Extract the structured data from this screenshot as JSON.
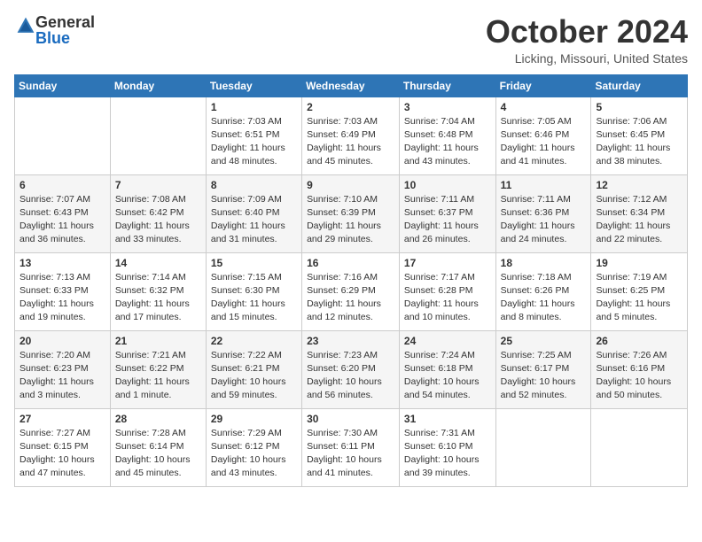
{
  "logo": {
    "general": "General",
    "blue": "Blue"
  },
  "title": "October 2024",
  "location": "Licking, Missouri, United States",
  "headers": [
    "Sunday",
    "Monday",
    "Tuesday",
    "Wednesday",
    "Thursday",
    "Friday",
    "Saturday"
  ],
  "weeks": [
    [
      null,
      null,
      {
        "day": "1",
        "sunrise": "Sunrise: 7:03 AM",
        "sunset": "Sunset: 6:51 PM",
        "daylight": "Daylight: 11 hours and 48 minutes."
      },
      {
        "day": "2",
        "sunrise": "Sunrise: 7:03 AM",
        "sunset": "Sunset: 6:49 PM",
        "daylight": "Daylight: 11 hours and 45 minutes."
      },
      {
        "day": "3",
        "sunrise": "Sunrise: 7:04 AM",
        "sunset": "Sunset: 6:48 PM",
        "daylight": "Daylight: 11 hours and 43 minutes."
      },
      {
        "day": "4",
        "sunrise": "Sunrise: 7:05 AM",
        "sunset": "Sunset: 6:46 PM",
        "daylight": "Daylight: 11 hours and 41 minutes."
      },
      {
        "day": "5",
        "sunrise": "Sunrise: 7:06 AM",
        "sunset": "Sunset: 6:45 PM",
        "daylight": "Daylight: 11 hours and 38 minutes."
      }
    ],
    [
      {
        "day": "6",
        "sunrise": "Sunrise: 7:07 AM",
        "sunset": "Sunset: 6:43 PM",
        "daylight": "Daylight: 11 hours and 36 minutes."
      },
      {
        "day": "7",
        "sunrise": "Sunrise: 7:08 AM",
        "sunset": "Sunset: 6:42 PM",
        "daylight": "Daylight: 11 hours and 33 minutes."
      },
      {
        "day": "8",
        "sunrise": "Sunrise: 7:09 AM",
        "sunset": "Sunset: 6:40 PM",
        "daylight": "Daylight: 11 hours and 31 minutes."
      },
      {
        "day": "9",
        "sunrise": "Sunrise: 7:10 AM",
        "sunset": "Sunset: 6:39 PM",
        "daylight": "Daylight: 11 hours and 29 minutes."
      },
      {
        "day": "10",
        "sunrise": "Sunrise: 7:11 AM",
        "sunset": "Sunset: 6:37 PM",
        "daylight": "Daylight: 11 hours and 26 minutes."
      },
      {
        "day": "11",
        "sunrise": "Sunrise: 7:11 AM",
        "sunset": "Sunset: 6:36 PM",
        "daylight": "Daylight: 11 hours and 24 minutes."
      },
      {
        "day": "12",
        "sunrise": "Sunrise: 7:12 AM",
        "sunset": "Sunset: 6:34 PM",
        "daylight": "Daylight: 11 hours and 22 minutes."
      }
    ],
    [
      {
        "day": "13",
        "sunrise": "Sunrise: 7:13 AM",
        "sunset": "Sunset: 6:33 PM",
        "daylight": "Daylight: 11 hours and 19 minutes."
      },
      {
        "day": "14",
        "sunrise": "Sunrise: 7:14 AM",
        "sunset": "Sunset: 6:32 PM",
        "daylight": "Daylight: 11 hours and 17 minutes."
      },
      {
        "day": "15",
        "sunrise": "Sunrise: 7:15 AM",
        "sunset": "Sunset: 6:30 PM",
        "daylight": "Daylight: 11 hours and 15 minutes."
      },
      {
        "day": "16",
        "sunrise": "Sunrise: 7:16 AM",
        "sunset": "Sunset: 6:29 PM",
        "daylight": "Daylight: 11 hours and 12 minutes."
      },
      {
        "day": "17",
        "sunrise": "Sunrise: 7:17 AM",
        "sunset": "Sunset: 6:28 PM",
        "daylight": "Daylight: 11 hours and 10 minutes."
      },
      {
        "day": "18",
        "sunrise": "Sunrise: 7:18 AM",
        "sunset": "Sunset: 6:26 PM",
        "daylight": "Daylight: 11 hours and 8 minutes."
      },
      {
        "day": "19",
        "sunrise": "Sunrise: 7:19 AM",
        "sunset": "Sunset: 6:25 PM",
        "daylight": "Daylight: 11 hours and 5 minutes."
      }
    ],
    [
      {
        "day": "20",
        "sunrise": "Sunrise: 7:20 AM",
        "sunset": "Sunset: 6:23 PM",
        "daylight": "Daylight: 11 hours and 3 minutes."
      },
      {
        "day": "21",
        "sunrise": "Sunrise: 7:21 AM",
        "sunset": "Sunset: 6:22 PM",
        "daylight": "Daylight: 11 hours and 1 minute."
      },
      {
        "day": "22",
        "sunrise": "Sunrise: 7:22 AM",
        "sunset": "Sunset: 6:21 PM",
        "daylight": "Daylight: 10 hours and 59 minutes."
      },
      {
        "day": "23",
        "sunrise": "Sunrise: 7:23 AM",
        "sunset": "Sunset: 6:20 PM",
        "daylight": "Daylight: 10 hours and 56 minutes."
      },
      {
        "day": "24",
        "sunrise": "Sunrise: 7:24 AM",
        "sunset": "Sunset: 6:18 PM",
        "daylight": "Daylight: 10 hours and 54 minutes."
      },
      {
        "day": "25",
        "sunrise": "Sunrise: 7:25 AM",
        "sunset": "Sunset: 6:17 PM",
        "daylight": "Daylight: 10 hours and 52 minutes."
      },
      {
        "day": "26",
        "sunrise": "Sunrise: 7:26 AM",
        "sunset": "Sunset: 6:16 PM",
        "daylight": "Daylight: 10 hours and 50 minutes."
      }
    ],
    [
      {
        "day": "27",
        "sunrise": "Sunrise: 7:27 AM",
        "sunset": "Sunset: 6:15 PM",
        "daylight": "Daylight: 10 hours and 47 minutes."
      },
      {
        "day": "28",
        "sunrise": "Sunrise: 7:28 AM",
        "sunset": "Sunset: 6:14 PM",
        "daylight": "Daylight: 10 hours and 45 minutes."
      },
      {
        "day": "29",
        "sunrise": "Sunrise: 7:29 AM",
        "sunset": "Sunset: 6:12 PM",
        "daylight": "Daylight: 10 hours and 43 minutes."
      },
      {
        "day": "30",
        "sunrise": "Sunrise: 7:30 AM",
        "sunset": "Sunset: 6:11 PM",
        "daylight": "Daylight: 10 hours and 41 minutes."
      },
      {
        "day": "31",
        "sunrise": "Sunrise: 7:31 AM",
        "sunset": "Sunset: 6:10 PM",
        "daylight": "Daylight: 10 hours and 39 minutes."
      },
      null,
      null
    ]
  ]
}
